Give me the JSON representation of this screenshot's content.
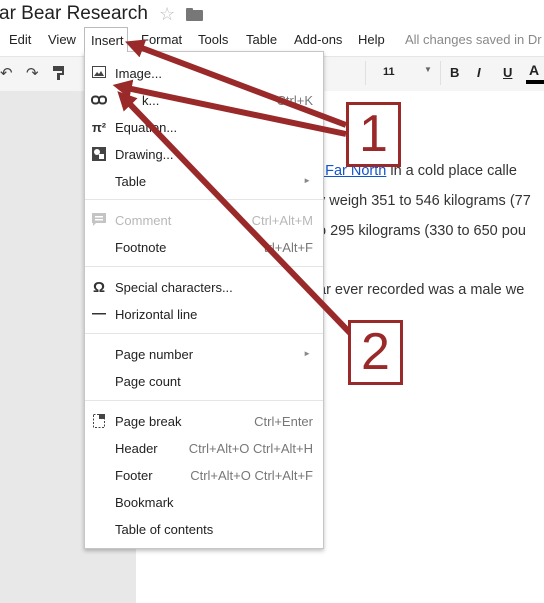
{
  "title_bar": {
    "doc_title": "ar Bear Research"
  },
  "menubar": {
    "items": [
      "Edit",
      "View",
      "Insert",
      "Format",
      "Tools",
      "Table",
      "Add-ons",
      "Help"
    ],
    "save_status": "All changes saved in Dr"
  },
  "toolbar": {
    "font_size": "11",
    "bold_label": "B",
    "italic_label": "I",
    "underline_label": "U",
    "text_color_label": "A",
    "text_color": "#000000"
  },
  "document": {
    "line1_link": "e Far North",
    "line1_rest": " in a cold place calle",
    "line2": "y weigh 351 to 546 kilograms (77",
    "line3": "o 295 kilograms (330 to 650 pou",
    "line4": "ar ever recorded was a male we"
  },
  "insert_menu": {
    "items": [
      {
        "label": "Image...",
        "icon": "image-icon",
        "shortcut": "",
        "disabled": false,
        "submenu": false
      },
      {
        "label": "k...",
        "icon": "link-icon",
        "shortcut": "Ctrl+K",
        "disabled": false,
        "submenu": false
      },
      {
        "label": "Equation...",
        "icon": "equation-icon",
        "shortcut": "",
        "disabled": false,
        "submenu": false
      },
      {
        "label": "Drawing...",
        "icon": "drawing-icon",
        "shortcut": "",
        "disabled": false,
        "submenu": false
      },
      {
        "label": "Table",
        "icon": "",
        "shortcut": "",
        "disabled": false,
        "submenu": true
      },
      {
        "label": "Comment",
        "icon": "comment-icon",
        "shortcut": "Ctrl+Alt+M",
        "disabled": true,
        "submenu": false
      },
      {
        "label": "Footnote",
        "icon": "",
        "shortcut": "trl+Alt+F",
        "disabled": false,
        "submenu": false
      },
      {
        "label": "Special characters...",
        "icon": "omega-icon",
        "shortcut": "",
        "disabled": false,
        "submenu": false
      },
      {
        "label": "Horizontal line",
        "icon": "horizontal-line-icon",
        "shortcut": "",
        "disabled": false,
        "submenu": false
      },
      {
        "label": "Page number",
        "icon": "",
        "shortcut": "",
        "disabled": false,
        "submenu": true
      },
      {
        "label": "Page count",
        "icon": "",
        "shortcut": "",
        "disabled": false,
        "submenu": false
      },
      {
        "label": "Page break",
        "icon": "page-break-icon",
        "shortcut": "Ctrl+Enter",
        "disabled": false,
        "submenu": false
      },
      {
        "label": "Header",
        "icon": "",
        "shortcut": "Ctrl+Alt+O Ctrl+Alt+H",
        "disabled": false,
        "submenu": false
      },
      {
        "label": "Footer",
        "icon": "",
        "shortcut": "Ctrl+Alt+O Ctrl+Alt+F",
        "disabled": false,
        "submenu": false
      },
      {
        "label": "Bookmark",
        "icon": "",
        "shortcut": "",
        "disabled": false,
        "submenu": false
      },
      {
        "label": "Table of contents",
        "icon": "",
        "shortcut": "",
        "disabled": false,
        "submenu": false
      }
    ]
  },
  "annotations": {
    "badge1": "1",
    "badge2": "2",
    "color": "#9a2a2a"
  }
}
